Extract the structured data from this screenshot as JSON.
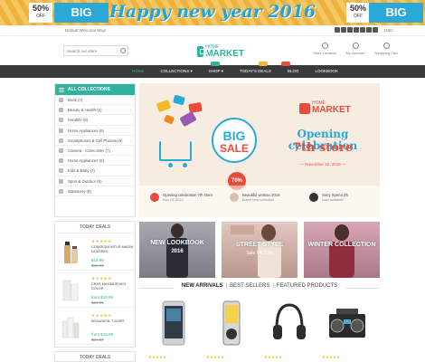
{
  "promo": {
    "left_pct": "50%",
    "left_off": "OFF",
    "left_sale": "BIG SALE",
    "headline": "Happy new year 2016",
    "right_pct": "50%",
    "right_off": "OFF",
    "right_sale": "BIG SALE"
  },
  "topbar": {
    "welcome": "Default Welcome Msg!",
    "currency": "USD"
  },
  "header": {
    "search_placeholder": "Search our store",
    "logo_home": "HOME",
    "logo_market": "MARKET",
    "icons": [
      {
        "label": "Store Location"
      },
      {
        "label": "My Account"
      },
      {
        "label": "Shopping Cart"
      }
    ]
  },
  "nav": {
    "items": [
      "HOME",
      "COLLECTIONS",
      "SHOP",
      "TODAY'S DEALS",
      "BLOG",
      "LOOKBOOK"
    ]
  },
  "categories": {
    "title": "ALL COLLECTIONS",
    "items": [
      "Book (7)",
      "Beauty & Health (6)",
      "Handlife (6)",
      "Home Appliances (6)",
      "Smartphones & Cell Phones (9)",
      "Camera - Camcorder (7)",
      "Home Appliances (6)",
      "Kids & Baby (7)",
      "Sport & Outdoor (6)",
      "Stationery (8)"
    ]
  },
  "deals": {
    "title": "TODAY DEALS",
    "items": [
      {
        "stars": "★★★★★",
        "name": "CONSEQUUNTUR MAGNI DOLORES",
        "price": "$19.99",
        "old": "$24.00"
      },
      {
        "stars": "★★★★★",
        "name": "CRAS MAXIMUS NISI DOLOR",
        "price": "from $19.99",
        "old": "$24.00"
      },
      {
        "stars": "★★★★★",
        "name": "BEAUDIFUL T-SHIRT",
        "price": "from $19.99",
        "old": "$24.00"
      }
    ],
    "title2": "TODAY DEALS"
  },
  "slider": {
    "big1": "BIG",
    "big2": "SALE",
    "pct": "70%",
    "logo_home": "HOME",
    "logo_market": "MARKET",
    "opening": "Opening celebration",
    "store": "7th store",
    "date": "— November 15, 2015 —",
    "thumbs": [
      {
        "title": "Opening celebration 7th store",
        "sub": "Nov 15, 2015"
      },
      {
        "title": "Beautiful woman 2016",
        "sub": "Brand new collection"
      },
      {
        "title": "Sony Xperia Z5",
        "sub": "Now available"
      }
    ]
  },
  "banners": [
    {
      "label": "NEW LOOKBOOK",
      "sub": "2016"
    },
    {
      "label": "STREET STYLE",
      "sub": "Sale Off 20%"
    },
    {
      "label": "WINTER COLLECTION",
      "sub": ""
    }
  ],
  "product_tabs": [
    "NEW ARRIVALS",
    "BEST SELLERS",
    "FEATURED PRODUCTS"
  ],
  "products": [
    {
      "name": "smartphone",
      "stars": "★★★★★"
    },
    {
      "name": "mp3 player",
      "stars": "★★★★★"
    },
    {
      "name": "headphones",
      "stars": "★★★★★"
    },
    {
      "name": "boombox",
      "stars": "★★★★★"
    }
  ],
  "colors": {
    "accent": "#2db3a0",
    "nav_bg": "#3a3a3a",
    "promo_blue": "#2aa8d8",
    "sale_red": "#e74c3c"
  }
}
